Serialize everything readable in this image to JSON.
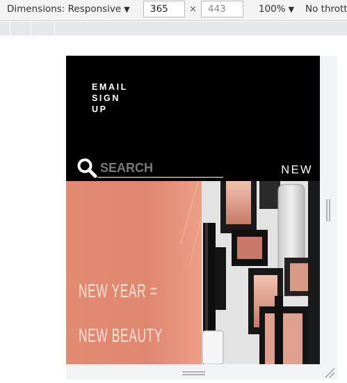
{
  "toolbar": {
    "dimensions_label": "Dimensions: Responsive",
    "dimensions_arrow": "▼",
    "width_value": "365",
    "height_placeholder": "443",
    "times_symbol": "×",
    "zoom_label": "100%",
    "zoom_arrow": "▼",
    "throttle_label": "No thrott"
  },
  "page": {
    "email_signup": "EMAIL SIGN UP",
    "search_placeholder": "SEARCH",
    "nav_new": "NEW",
    "hero": {
      "line1": "NEW YEAR =",
      "line2": "NEW BEAUTY",
      "bg_color": "#e08870"
    }
  }
}
